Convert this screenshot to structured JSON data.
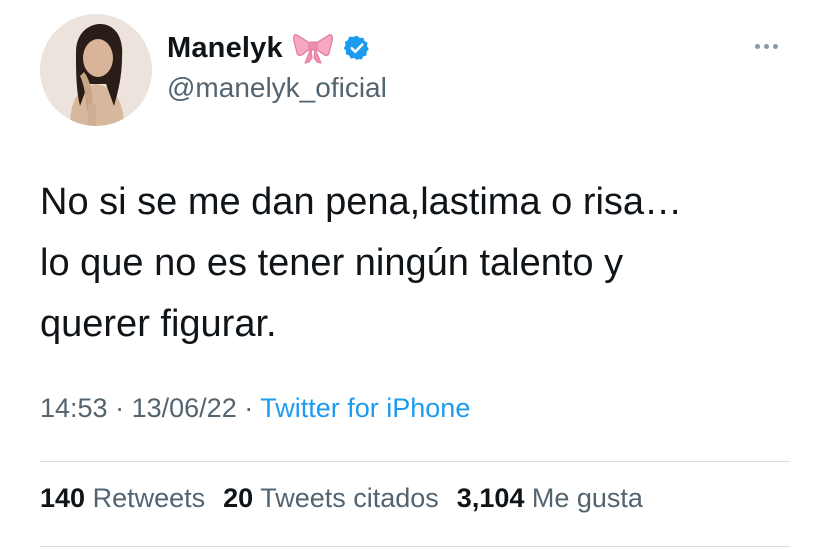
{
  "author": {
    "display_name": "Manelyk",
    "handle": "@manelyk_oficial",
    "bow_icon": "bow-emoji-icon",
    "verified_icon": "verified-badge-icon"
  },
  "tweet": {
    "text_lines": [
      "No si se me dan pena,lastima o risa…",
      "lo que no es tener ningún talento y",
      "querer figurar."
    ],
    "time": "14:53",
    "separator": "·",
    "date": "13/06/22",
    "source": "Twitter for iPhone"
  },
  "stats": {
    "retweets_count": "140",
    "retweets_label": "Retweets",
    "quotes_count": "20",
    "quotes_label": "Tweets citados",
    "likes_count": "3,104",
    "likes_label": "Me gusta"
  },
  "colors": {
    "text": "#0f1419",
    "secondary": "#536471",
    "link": "#1d9bf0",
    "verified": "#1d9bf0",
    "divider": "#d9dde0"
  }
}
